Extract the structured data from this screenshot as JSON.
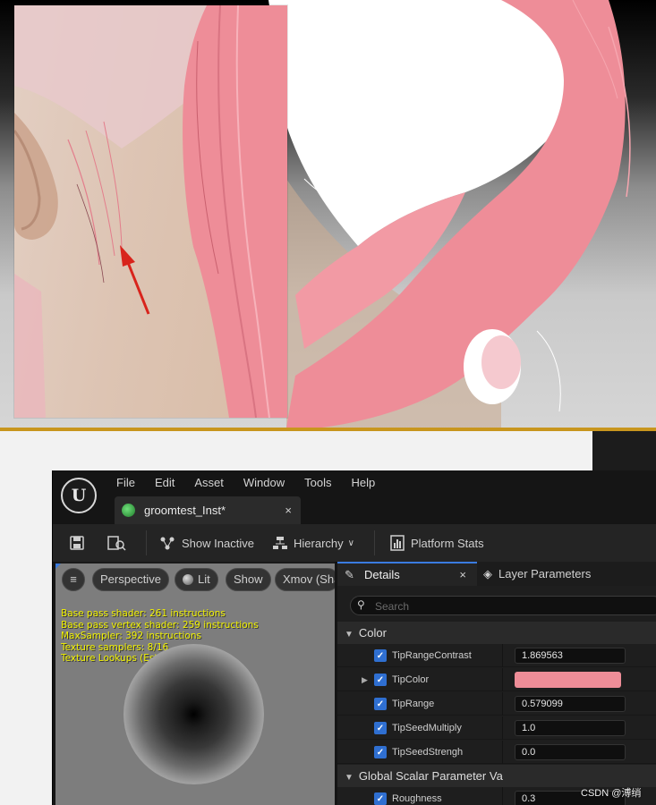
{
  "menu": [
    "File",
    "Edit",
    "Asset",
    "Window",
    "Tools",
    "Help"
  ],
  "asset_tab": {
    "label": "groomtest_Inst*",
    "close": "×"
  },
  "toolbar": {
    "show_inactive": "Show Inactive",
    "hierarchy": "Hierarchy",
    "platform_stats": "Platform Stats"
  },
  "viewport": {
    "perspective": "Perspective",
    "lit": "Lit",
    "show": "Show",
    "xmov": "Xmov (Sha",
    "stats": [
      "Base pass shader: 261 instructions",
      "Base pass vertex shader: 259 instructions",
      "MaxSampler: 392 instructions",
      "Texture samplers: 8/16",
      "Texture Lookups (Est.): VS(0), PS(4)"
    ]
  },
  "details": {
    "tab_label": "Details",
    "tab_close": "×",
    "layer_tab": "Layer Parameters",
    "search_placeholder": "Search",
    "categories": {
      "color": "Color",
      "global_scalar": "Global Scalar Parameter Va"
    },
    "color_params": [
      {
        "name": "TipRangeContrast",
        "value": "1.869563"
      },
      {
        "name": "TipColor",
        "value": ""
      },
      {
        "name": "TipRange",
        "value": "0.579099"
      },
      {
        "name": "TipSeedMultiply",
        "value": "1.0"
      },
      {
        "name": "TipSeedStrengh",
        "value": "0.0"
      }
    ],
    "scalar_params": [
      {
        "name": "Roughness",
        "value": "0.3"
      }
    ],
    "tip_color_hex": "#ee8d98"
  },
  "watermark": "CSDN @溥绡",
  "colors": {
    "accent": "#3a7be0",
    "hair_pink": "#ee8d98",
    "checkbox": "#2f6fd1"
  }
}
